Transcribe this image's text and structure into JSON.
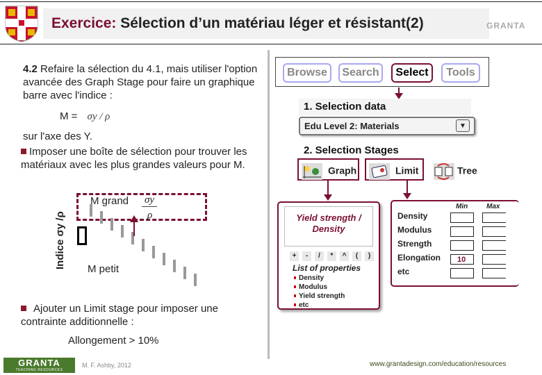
{
  "header": {
    "title_prefix": "Exercice:",
    "title_rest": " Sélection d’un matériau léger et résistant(2)",
    "logo_right": "GRANTA"
  },
  "left": {
    "intro_num": "4.2",
    "intro_text": " Refaire la sélection du 4.1, mais utiliser l'option avancée des Graph Stage pour faire un graphique barre avec l'indice :",
    "formula_lhs": "M =",
    "formula_rhs": "σy / ρ",
    "axis_text": "sur l'axe des Y.",
    "bullet1": "Imposer une boîte de sélection pour trouver les matériaux avec les plus grandes valeurs pour M.",
    "chart": {
      "y_label": "Indice σy /ρ",
      "m_grand": "M grand",
      "m_petit": "M petit",
      "fraction_num": "σy",
      "fraction_den": "ρ"
    },
    "bullet2": "Ajouter un Limit stage pour imposer une contrainte additionnelle :",
    "constraint": "Allongement > 10%"
  },
  "app": {
    "tabs": [
      {
        "label": "Browse",
        "selected": false
      },
      {
        "label": "Search",
        "selected": false
      },
      {
        "label": "Select",
        "selected": true
      },
      {
        "label": "Tools",
        "selected": false
      }
    ],
    "selection_data_title": "1. Selection data",
    "selection_data_value": "Edu Level 2: Materials",
    "stages_title": "2. Selection Stages",
    "stages": [
      {
        "label": "Graph",
        "icon": "graph-icon"
      },
      {
        "label": "Limit",
        "icon": "limit-icon"
      },
      {
        "label": "Tree",
        "icon": "tree-icon"
      }
    ],
    "graph_panel": {
      "expression": "Yield strength / Density",
      "operators": [
        "+",
        "-",
        "/",
        "*",
        "^",
        "(",
        ")"
      ],
      "props_title": "List of properties",
      "properties": [
        "Density",
        "Modulus",
        "Yield strength",
        "etc"
      ]
    },
    "limit_panel": {
      "min_label": "Min",
      "max_label": "Max",
      "rows": [
        {
          "label": "Density",
          "min": "",
          "max": ""
        },
        {
          "label": "Modulus",
          "min": "",
          "max": ""
        },
        {
          "label": "Strength",
          "min": "",
          "max": ""
        },
        {
          "label": "Elongation",
          "min": "10",
          "max": ""
        },
        {
          "label": "etc",
          "min": "",
          "max": ""
        }
      ]
    }
  },
  "footer": {
    "logo": "GRANTA",
    "logo_sub": "TEACHING RESOURCES",
    "author": "M. F. Ashby, 2012",
    "url": "www.grantadesign.com/education/resources"
  }
}
